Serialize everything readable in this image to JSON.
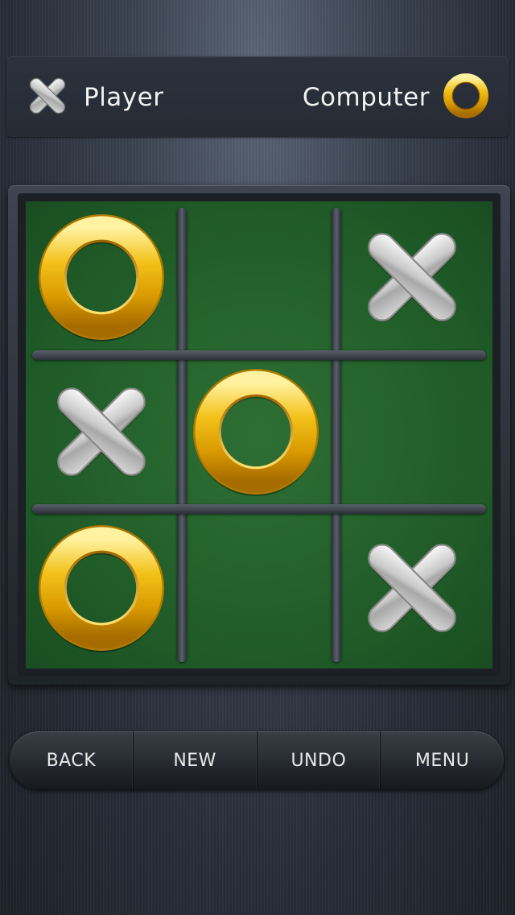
{
  "header": {
    "player_label": "Player",
    "computer_label": "Computer",
    "player_icon": "x-mark-icon",
    "computer_icon": "o-ring-icon"
  },
  "board": {
    "cells": [
      [
        "O",
        "",
        "X"
      ],
      [
        "X",
        "O",
        ""
      ],
      [
        "O",
        "",
        "X"
      ]
    ],
    "colors": {
      "felt": "#1f5a27",
      "o_piece": "#e8b000",
      "x_piece": "#c8c8c8"
    }
  },
  "toolbar": {
    "back_label": "BACK",
    "new_label": "NEW",
    "undo_label": "UNDO",
    "menu_label": "MENU"
  }
}
